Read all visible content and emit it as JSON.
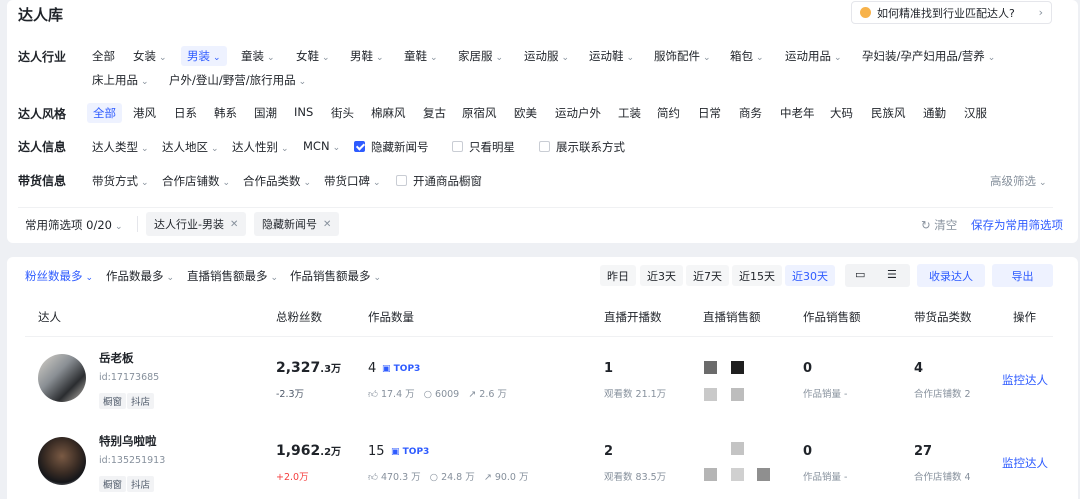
{
  "header": {
    "title": "达人库",
    "help_text": "如何精准找到行业匹配达人?"
  },
  "filters": {
    "industry": {
      "label": "达人行业",
      "options": [
        "全部",
        "女装",
        "男装",
        "童装",
        "女鞋",
        "男鞋",
        "童鞋",
        "家居服",
        "运动服",
        "运动鞋",
        "服饰配件",
        "箱包",
        "运动用品",
        "孕妇装/孕产妇用品/营养",
        "床上用品",
        "户外/登山/野营/旅行用品"
      ],
      "selected": "男装"
    },
    "style": {
      "label": "达人风格",
      "options": [
        "全部",
        "港风",
        "日系",
        "韩系",
        "国潮",
        "INS",
        "街头",
        "棉麻风",
        "复古",
        "原宿风",
        "欧美",
        "运动户外",
        "工装",
        "简约",
        "日常",
        "商务",
        "中老年",
        "大码",
        "民族风",
        "通勤",
        "汉服"
      ],
      "selected": "全部"
    },
    "info": {
      "label": "达人信息",
      "dropdowns": [
        "达人类型",
        "达人地区",
        "达人性别",
        "MCN"
      ],
      "checkboxes": [
        {
          "label": "隐藏新闻号",
          "checked": true
        },
        {
          "label": "只看明星",
          "checked": false
        },
        {
          "label": "展示联系方式",
          "checked": false
        }
      ]
    },
    "sales": {
      "label": "带货信息",
      "dropdowns": [
        "带货方式",
        "合作店铺数",
        "合作品类数",
        "带货口碑"
      ],
      "checkboxes": [
        {
          "label": "开通商品橱窗",
          "checked": false
        }
      ],
      "advanced": "高级筛选"
    },
    "saved": {
      "label": "常用筛选项 0/20",
      "tags": [
        "达人行业-男装",
        "隐藏新闻号"
      ],
      "clear": "清空",
      "save": "保存为常用筛选项"
    }
  },
  "toolbar": {
    "sorts": [
      "粉丝数最多",
      "作品数最多",
      "直播销售额最多",
      "作品销售额最多"
    ],
    "active_sort": "粉丝数最多",
    "periods": [
      "昨日",
      "近3天",
      "近7天",
      "近15天",
      "近30天"
    ],
    "active_period": "近30天",
    "collect": "收录达人",
    "export": "导出"
  },
  "table": {
    "headers": [
      "达人",
      "总粉丝数",
      "作品数量",
      "直播开播数",
      "直播销售额",
      "作品销售额",
      "带货品类数",
      "操作"
    ],
    "rows": [
      {
        "name": "岳老板",
        "id": "id:17173685",
        "tags": [
          "橱窗",
          "抖店"
        ],
        "fans_main": "2,327",
        "fans_dec": ".3万",
        "fans_change": "-2.3万",
        "works": "4",
        "top3": "TOP3",
        "likes": "17.4 万",
        "comments": "6009",
        "shares": "2.6 万",
        "live_count": "1",
        "live_views": "观看数 21.1万",
        "work_sales": "0",
        "work_sales_sub": "作品销量 -",
        "categories": "4",
        "shops": "合作店铺数 2",
        "action": "监控达人"
      },
      {
        "name": "特别乌啦啦",
        "id": "id:135251913",
        "tags": [
          "橱窗",
          "抖店"
        ],
        "fans_main": "1,962",
        "fans_dec": ".2万",
        "fans_change": "+2.0万",
        "works": "15",
        "top3": "TOP3",
        "likes": "470.3 万",
        "comments": "24.8 万",
        "shares": "90.0 万",
        "live_count": "2",
        "live_views": "观看数 83.5万",
        "work_sales": "0",
        "work_sales_sub": "作品销量 -",
        "categories": "27",
        "shops": "合作店铺数 4",
        "action": "监控达人"
      }
    ]
  },
  "colors": {
    "accent": "#2e5bff",
    "negative": "#86909c",
    "positive": "#f53f3f"
  }
}
